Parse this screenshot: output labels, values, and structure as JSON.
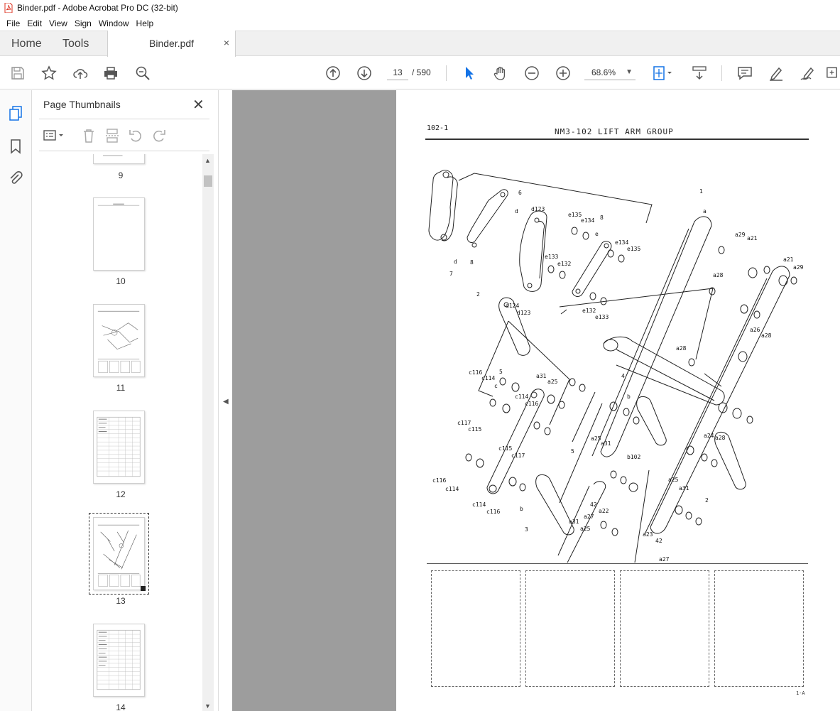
{
  "window": {
    "title": "Binder.pdf - Adobe Acrobat Pro DC (32-bit)"
  },
  "menu": [
    "File",
    "Edit",
    "View",
    "Sign",
    "Window",
    "Help"
  ],
  "tabs": {
    "home": "Home",
    "tools": "Tools",
    "document": "Binder.pdf",
    "close": "×"
  },
  "toolbar": {
    "current_page": "13",
    "page_total": "/ 590",
    "zoom": "68.6%",
    "icons": [
      "save-icon",
      "star-icon",
      "upload-icon",
      "print-icon",
      "search-zoom-icon",
      "page-up-icon",
      "page-down-icon",
      "select-cursor-icon",
      "hand-icon",
      "zoom-out-icon",
      "zoom-in-icon",
      "fit-page-icon",
      "scroll-mode-icon",
      "comment-icon",
      "highlight-icon",
      "sign-icon",
      "more-tools-icon"
    ]
  },
  "left_rail": {
    "icons": [
      "pages-icon",
      "bookmark-icon",
      "attachment-icon"
    ]
  },
  "thumbnails_panel": {
    "title": "Page Thumbnails",
    "close": "✕",
    "tools": [
      "options-menu-icon",
      "delete-icon",
      "extract-icon",
      "rotate-left-icon",
      "rotate-right-icon"
    ],
    "pages": [
      {
        "label": "9",
        "kind": "header"
      },
      {
        "label": "10",
        "kind": "blank"
      },
      {
        "label": "11",
        "kind": "diagram"
      },
      {
        "label": "12",
        "kind": "table"
      },
      {
        "label": "13",
        "kind": "diagram",
        "selected": true
      },
      {
        "label": "14",
        "kind": "table"
      }
    ]
  },
  "document_page": {
    "header_left": "102-1",
    "header_title": "NM3-102   LIFT ARM GROUP",
    "footer": "1-A",
    "callouts": [
      "1",
      "a",
      "2",
      "3",
      "b",
      "4",
      "5",
      "6",
      "7",
      "8",
      "d",
      "e",
      "c",
      "d123",
      "d124",
      "e132",
      "e133",
      "e134",
      "e135",
      "a21",
      "a22",
      "a23",
      "a24",
      "a25",
      "a26",
      "a27",
      "a28",
      "a29",
      "a31",
      "42",
      "b102",
      "c114",
      "c115",
      "c116",
      "c117"
    ]
  }
}
